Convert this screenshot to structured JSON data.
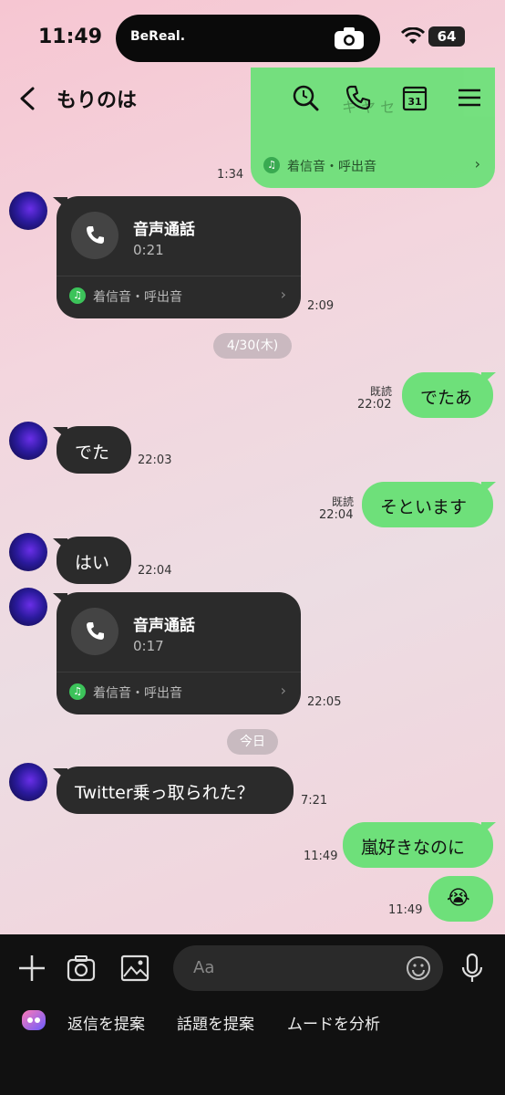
{
  "status_bar": {
    "time": "11:49",
    "bereal_label": "BeReal.",
    "battery": "64"
  },
  "header": {
    "title": "もりのは"
  },
  "top_card": {
    "ringtone_label": "着信音・呼出音",
    "partial_text": "キ ヤ セ"
  },
  "messages": [
    {
      "side": "right",
      "time": "1:34"
    },
    {
      "side": "left",
      "type": "call",
      "title": "音声通話",
      "duration": "0:21",
      "ringtone": "着信音・呼出音",
      "time": "2:09"
    },
    {
      "type": "date",
      "label": "4/30(木)"
    },
    {
      "side": "right",
      "text": "でたあ",
      "read": "既読",
      "time": "22:02"
    },
    {
      "side": "left",
      "text": "でた",
      "time": "22:03"
    },
    {
      "side": "right",
      "text": "そといます",
      "read": "既読",
      "time": "22:04"
    },
    {
      "side": "left",
      "text": "はい",
      "time": "22:04"
    },
    {
      "side": "left",
      "type": "call",
      "title": "音声通話",
      "duration": "0:17",
      "ringtone": "着信音・呼出音",
      "time": "22:05"
    },
    {
      "type": "date",
      "label": "今日"
    },
    {
      "side": "left",
      "text": "Twitter乗っ取られた？",
      "time": "7:21"
    },
    {
      "side": "right",
      "text": "嵐好きなのに",
      "time": "11:49"
    },
    {
      "side": "right",
      "text": "😭",
      "time": "11:49"
    }
  ],
  "input": {
    "placeholder": "Aa"
  },
  "suggestions": [
    "返信を提案",
    "話題を提案",
    "ムードを分析"
  ]
}
